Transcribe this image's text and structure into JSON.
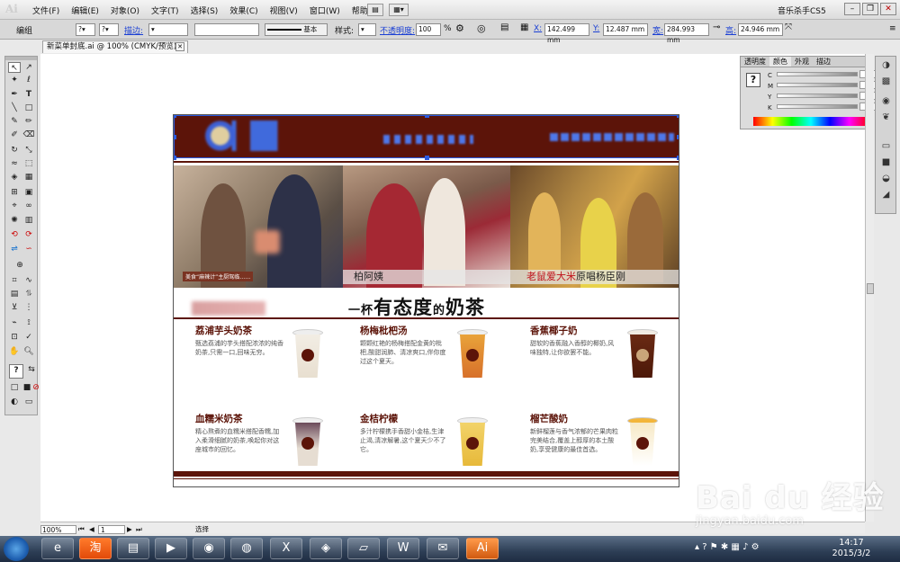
{
  "app": {
    "logo": "Ai",
    "workspace": "音乐杀手CS5"
  },
  "menu": {
    "items": [
      "文件(F)",
      "编辑(E)",
      "对象(O)",
      "文字(T)",
      "选择(S)",
      "效果(C)",
      "视图(V)",
      "窗口(W)",
      "帮助(H)"
    ]
  },
  "controlbar": {
    "mode": "编组",
    "stroke_label": "描边:",
    "stroke_preset": "基本",
    "style_label": "样式:",
    "opacity_label": "不透明度:",
    "opacity_value": "100",
    "percent": "%",
    "x_label": "X:",
    "x_value": "142.499 mm",
    "y_label": "Y:",
    "y_value": "12.487 mm",
    "w_label": "宽:",
    "w_value": "284.993 mm",
    "h_label": "高:",
    "h_value": "24.946 mm"
  },
  "document": {
    "tab_title": "新菜单封底.ai @ 100% (CMYK/预览)"
  },
  "artboard": {
    "photo_captions": {
      "photo1_small": "美食“麻辣计”主厨驾临……",
      "photo2": "柏阿姨",
      "photo3_red": "老鼠爱大米",
      "photo3_rest": "原唱杨臣刚"
    },
    "slogan": {
      "part1": "一杯",
      "part2": "有态度",
      "part3": "的",
      "part4": "奶茶"
    },
    "items": [
      {
        "title": "荔浦芋头奶茶",
        "desc": "甄选荔浦的芋头搭配浓浓的纯香奶茶,只需一口,回味无穷。"
      },
      {
        "title": "杨梅枇杷汤",
        "desc": "颗颗红艳的杨梅搭配金黄的枇杷,酸甜润肺、清凉爽口,伴你度过这个夏天。"
      },
      {
        "title": "香蕉椰子奶",
        "desc": "甜软的香蕉融入香醇的椰奶,风味独特,让你欲罢不能。"
      },
      {
        "title": "血糯米奶茶",
        "desc": "精心熬煮的血糯米搭配香糯,加入柔滑细腻的奶茶,唤起你对这座城市的回忆。"
      },
      {
        "title": "金桔柠檬",
        "desc": "多汁柠檬携手香甜小金桔,生津止渴,清凉解暑,这个夏天少不了它。"
      },
      {
        "title": "榴芒酸奶",
        "desc": "新鲜榴莲与香气浓郁的芒果肉粒完美结合,覆盖上醇厚的本土酸奶,享受健康的最佳首选。"
      }
    ]
  },
  "color_panel": {
    "tabs": [
      "透明度",
      "颜色",
      "外观",
      "描边"
    ],
    "channels": [
      "C",
      "M",
      "Y",
      "K"
    ],
    "percent": "%"
  },
  "statusbar": {
    "zoom": "100%",
    "page": "1",
    "tool": "选择"
  },
  "taskbar": {
    "time": "14:17",
    "date": "2015/3/2",
    "apps": [
      "ie",
      "taobao",
      "explorer",
      "media",
      "360",
      "chrome",
      "excel",
      "qq",
      "note",
      "word",
      "mail",
      "illustrator"
    ]
  },
  "watermark": {
    "main": "Bai du 经验",
    "sub": "jingyan.baidu.com"
  },
  "colors": {
    "brand": "#5c1409",
    "selection": "#2c5be0",
    "link": "#1a3fd4"
  }
}
